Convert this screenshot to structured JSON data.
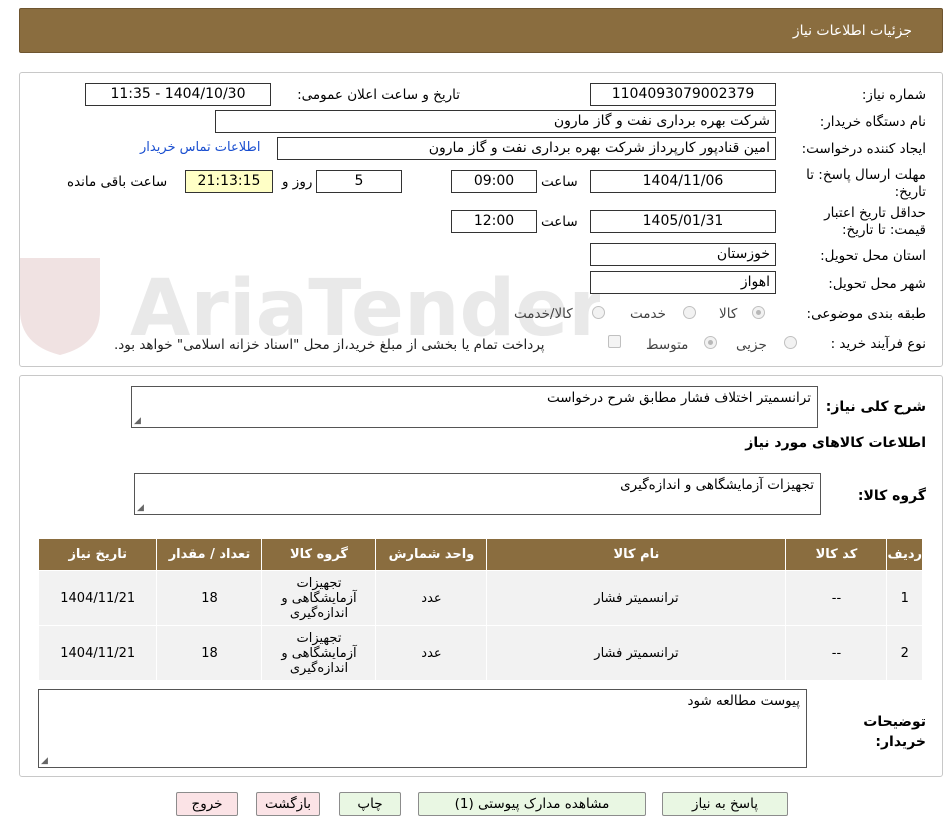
{
  "header": {
    "title": "جزئیات اطلاعات نیاز"
  },
  "form": {
    "need_number_label": "شماره نیاز:",
    "need_number": "1104093079002379",
    "announce_label": "تاریخ و ساعت اعلان عمومی:",
    "announce_value": "1404/10/30 - 11:35",
    "buyer_org_label": "نام دستگاه خریدار:",
    "buyer_org": "شرکت بهره برداری نفت و گاز مارون",
    "requester_label": "ایجاد کننده درخواست:",
    "requester": "امین قنادپور کارپرداز شرکت بهره برداری نفت و گاز مارون",
    "contact_link": "اطلاعات تماس خریدار",
    "deadline_label": "مهلت ارسال پاسخ: تا تاریخ:",
    "deadline_date": "1404/11/06",
    "time_label": "ساعت",
    "deadline_time": "09:00",
    "days_value": "5",
    "days_label": "روز و",
    "remaining_time": "21:13:15",
    "remaining_label": "ساعت باقی مانده",
    "validity_label": "حداقل تاریخ اعتبار قیمت: تا تاریخ:",
    "validity_date": "1405/01/31",
    "validity_time": "12:00",
    "province_label": "استان محل تحویل:",
    "province": "خوزستان",
    "city_label": "شهر محل تحویل:",
    "city": "اهواز",
    "category_label": "طبقه بندی موضوعی:",
    "category_options": [
      "کالا",
      "خدمت",
      "کالا/خدمت"
    ],
    "purchase_label": "نوع فرآیند خرید :",
    "purchase_options": [
      "جزیی",
      "متوسط"
    ],
    "payment_note": "پرداخت تمام یا بخشی از مبلغ خرید،از محل \"اسناد خزانه اسلامی\" خواهد بود."
  },
  "general": {
    "desc_label": "شرح کلی نیاز:",
    "desc_value": "ترانسمیتر اختلاف فشار مطابق شرح درخواست",
    "goods_info_title": "اطلاعات کالاهای مورد نیاز",
    "group_label": "گروه کالا:",
    "group_value": "تجهیزات آزمایشگاهی و اندازه‌گیری"
  },
  "table": {
    "headers": [
      "ردیف",
      "کد کالا",
      "نام کالا",
      "واحد شمارش",
      "گروه کالا",
      "تعداد / مقدار",
      "تاریخ نیاز"
    ],
    "rows": [
      [
        "1",
        "--",
        "ترانسمیتر فشار",
        "عدد",
        "تجهیزات آزمایشگاهی و اندازه‌گیری",
        "18",
        "1404/11/21"
      ],
      [
        "2",
        "--",
        "ترانسمیتر فشار",
        "عدد",
        "تجهیزات آزمایشگاهی و اندازه‌گیری",
        "18",
        "1404/11/21"
      ]
    ]
  },
  "notes": {
    "label": "توضیحات خریدار:",
    "value": "پیوست مطالعه شود"
  },
  "buttons": {
    "reply": "پاسخ به نیاز",
    "attachments": "مشاهده مدارک پیوستی (1)",
    "print": "چاپ",
    "back": "بازگشت",
    "exit": "خروج"
  },
  "watermark": {
    "text": "AriaTender.neT"
  },
  "colors": {
    "header_bg": "#8a6d3f",
    "link": "#1a4fd0",
    "remaining_bg": "#ffffc6"
  }
}
